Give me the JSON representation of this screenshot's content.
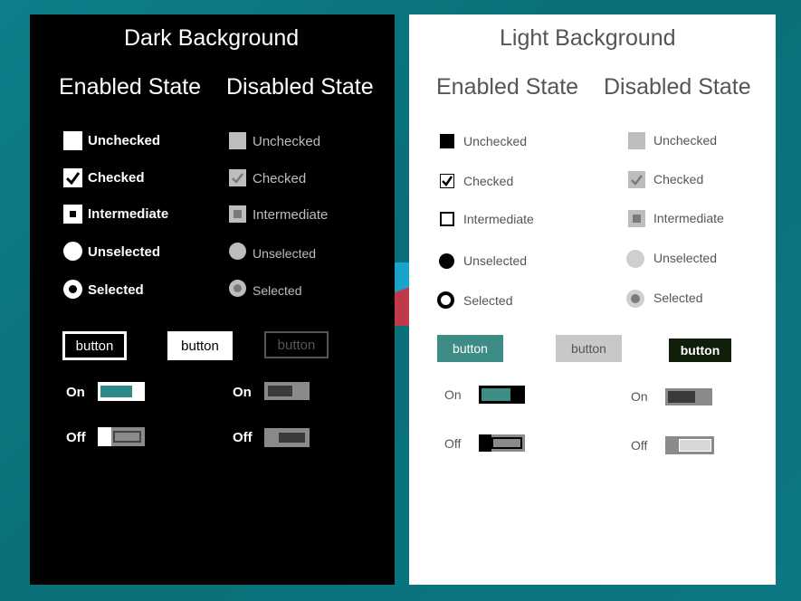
{
  "dark": {
    "title": "Dark Background",
    "enabled_heading": "Enabled State",
    "disabled_heading": "Disabled State",
    "labels": {
      "unchecked": "Unchecked",
      "checked": "Checked",
      "intermediate": "Intermediate",
      "unselected": "Unselected",
      "selected": "Selected"
    },
    "buttons": [
      "button",
      "button",
      "button"
    ],
    "switch_on": "On",
    "switch_off": "Off"
  },
  "light": {
    "title": "Light Background",
    "enabled_heading": "Enabled State",
    "disabled_heading": "Disabled State",
    "labels": {
      "unchecked": "Unchecked",
      "checked": "Checked",
      "intermediate": "Intermediate",
      "unselected": "Unselected",
      "selected": "Selected"
    },
    "buttons": [
      "button",
      "button",
      "button"
    ],
    "switch_on": "On",
    "switch_off": "Off"
  },
  "colors": {
    "accent": "#2e8a8a",
    "disabled_gray": "#bdbdbd",
    "dark_button_bg": "#0f1f0a"
  }
}
